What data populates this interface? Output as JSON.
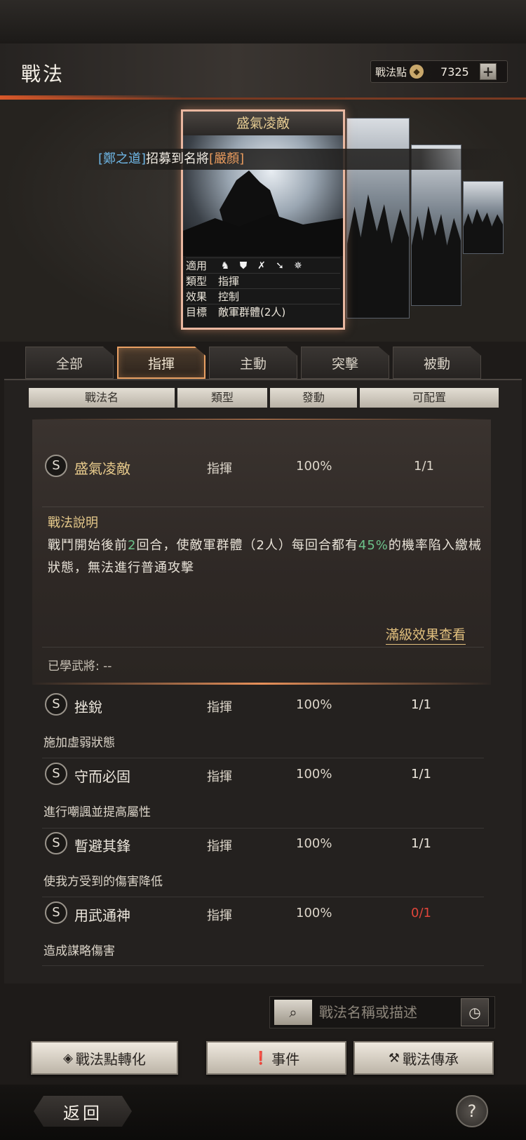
{
  "header": {
    "title": "戰法",
    "points_label": "戰法點",
    "points_value": "7325",
    "plus_label": "+"
  },
  "announcement": {
    "part1": "[鄭之道]",
    "part2": "招募到名將",
    "part3": "[嚴顏]"
  },
  "card": {
    "title": "盛氣凌敵",
    "rows": [
      {
        "key": "適用",
        "value": ""
      },
      {
        "key": "類型",
        "value": "指揮"
      },
      {
        "key": "效果",
        "value": "控制"
      },
      {
        "key": "目標",
        "value": "敵軍群體(2人)"
      }
    ],
    "unit_icons": [
      "cavalry-icon",
      "shield-icon",
      "bow-icon",
      "spear-icon",
      "chariot-icon"
    ]
  },
  "tabs": [
    {
      "label": "全部",
      "active": false
    },
    {
      "label": "指揮",
      "active": true
    },
    {
      "label": "主動",
      "active": false
    },
    {
      "label": "突擊",
      "active": false
    },
    {
      "label": "被動",
      "active": false
    }
  ],
  "columns": [
    "戰法名",
    "類型",
    "發動",
    "可配置"
  ],
  "expanded": {
    "badge": "S",
    "name": "盛氣凌敵",
    "type": "指揮",
    "rate": "100%",
    "slot": "1/1",
    "desc_title": "戰法說明",
    "desc_1": "戰鬥開始後前",
    "desc_2": "2",
    "desc_3": "回合，使敵軍群體（2人）每回合都有",
    "desc_4": "45%",
    "desc_5": "的機率陷入繳械狀態，無法進行普通攻擊",
    "full_link": "滿級效果查看",
    "learned": "已學武將: --"
  },
  "list": [
    {
      "badge": "S",
      "name": "挫銳",
      "type": "指揮",
      "rate": "100%",
      "slot": "1/1",
      "desc": "施加虛弱狀態",
      "slot_color": "#ece6dc"
    },
    {
      "badge": "S",
      "name": "守而必固",
      "type": "指揮",
      "rate": "100%",
      "slot": "1/1",
      "desc": "進行嘲諷並提高屬性",
      "slot_color": "#ece6dc"
    },
    {
      "badge": "S",
      "name": "暫避其鋒",
      "type": "指揮",
      "rate": "100%",
      "slot": "1/1",
      "desc": "使我方受到的傷害降低",
      "slot_color": "#ece6dc"
    },
    {
      "badge": "S",
      "name": "用武通神",
      "type": "指揮",
      "rate": "100%",
      "slot": "0/1",
      "desc": "造成謀略傷害",
      "slot_color": "#e0453a"
    }
  ],
  "search": {
    "placeholder": "戰法名稱或描述"
  },
  "buttons": {
    "convert": "戰法點轉化",
    "event": "事件",
    "inherit": "戰法傳承"
  },
  "footer": {
    "back": "返回",
    "help": "?"
  },
  "colors": {
    "accent_orange": "#e9a063",
    "gold_text": "#e6cc93",
    "highlight_green": "#6cc28a",
    "warning_red": "#e0453a",
    "link_blue": "#6fb7e6"
  }
}
